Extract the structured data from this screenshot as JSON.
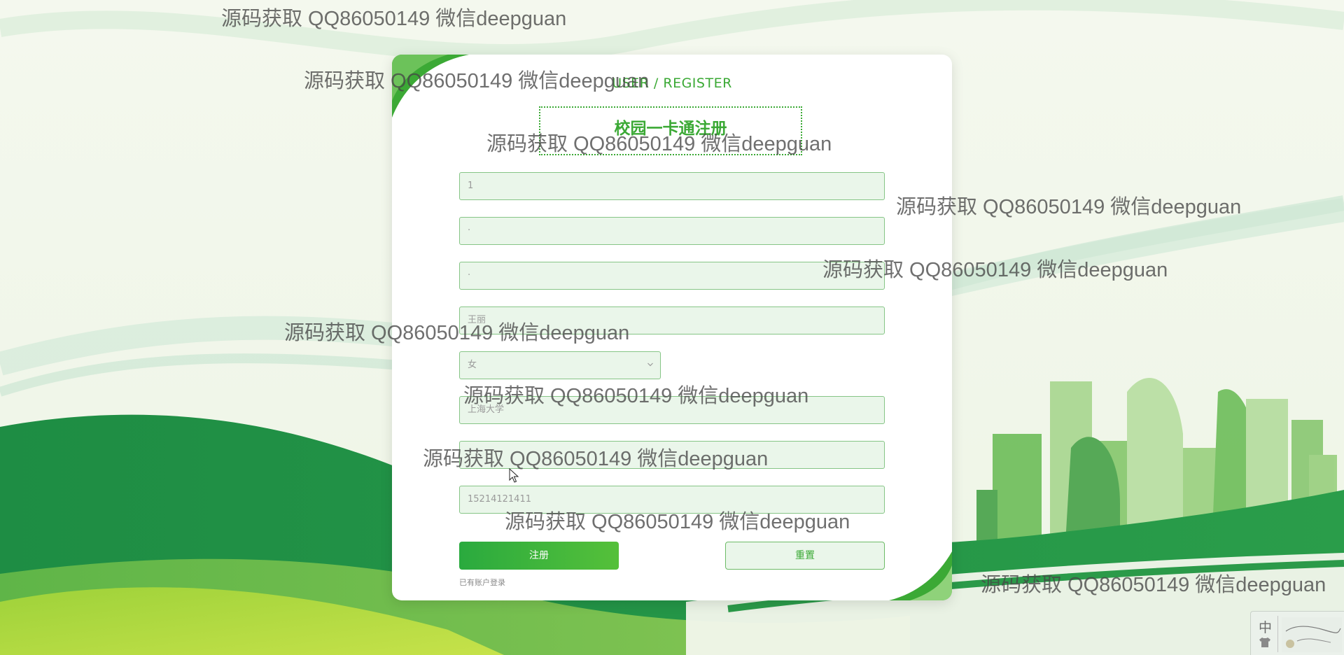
{
  "form": {
    "subtitle": "USER / REGISTER",
    "title": "校园一卡通注册",
    "fields": [
      {
        "name": "username",
        "value": "1"
      },
      {
        "name": "password",
        "value": "·"
      },
      {
        "name": "confirm-password",
        "value": "·"
      },
      {
        "name": "realname",
        "value": "王丽"
      },
      {
        "name": "school",
        "value": "上海大学"
      },
      {
        "name": "class",
        "value": ""
      },
      {
        "name": "phone",
        "value": "15214121411"
      }
    ],
    "gender": {
      "selected": "女"
    },
    "register_label": "注册",
    "reset_label": "重置",
    "login_link": "已有账户登录"
  },
  "watermark": "源码获取 QQ86050149 微信deepguan",
  "ime": {
    "mode": "中"
  },
  "colors": {
    "accent": "#3ba935",
    "field_bg": "#eaf6ea",
    "field_border": "#86c586"
  }
}
